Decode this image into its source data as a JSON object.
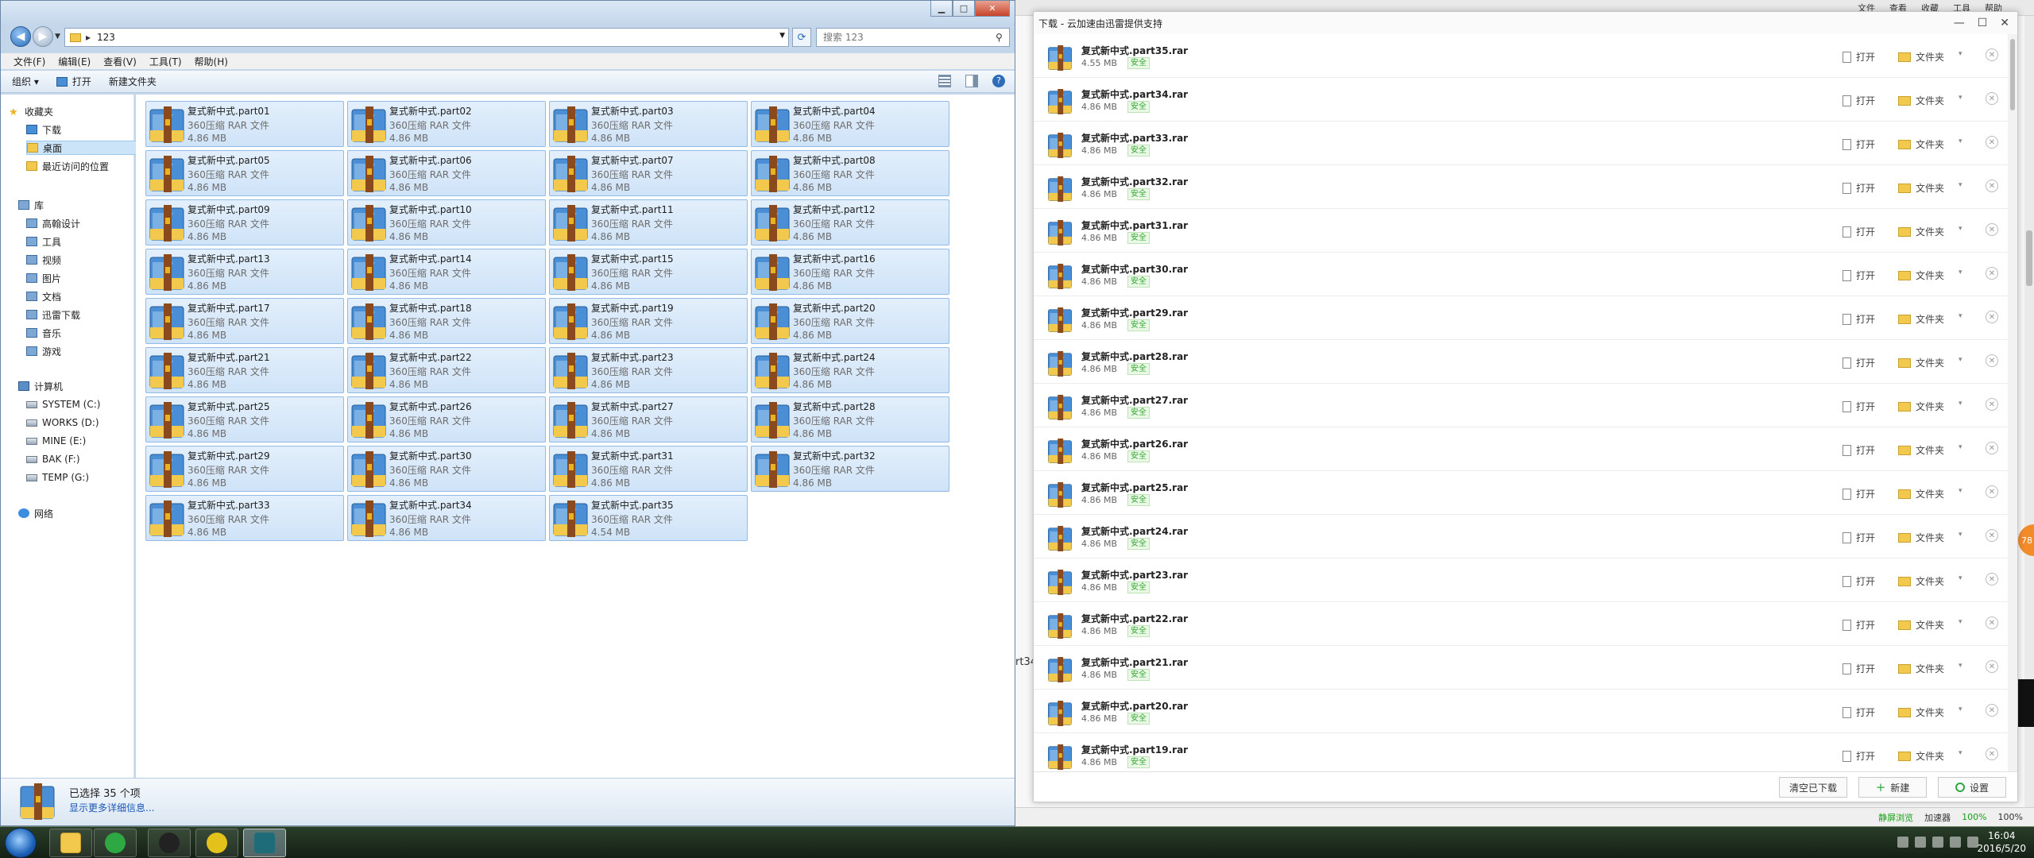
{
  "explorer": {
    "address_path": "123",
    "search_placeholder": "搜索 123",
    "menu": [
      "文件(F)",
      "编辑(E)",
      "查看(V)",
      "工具(T)",
      "帮助(H)"
    ],
    "toolbar": {
      "organize": "组织 ▾",
      "open": "打开",
      "new_folder": "新建文件夹"
    },
    "nav": {
      "favorites": "收藏夹",
      "fav_items": [
        "下载",
        "桌面",
        "最近访问的位置"
      ],
      "libraries": "库",
      "lib_items": [
        "高翰设计",
        "工具",
        "视频",
        "图片",
        "文档",
        "迅雷下载",
        "音乐",
        "游戏"
      ],
      "computer": "计算机",
      "drives": [
        "SYSTEM (C:)",
        "WORKS (D:)",
        "MINE (E:)",
        "BAK (F:)",
        "TEMP (G:)"
      ],
      "network": "网络"
    },
    "files": [
      {
        "name": "复式新中式.part01",
        "type": "360压缩 RAR 文件",
        "size": "4.86 MB"
      },
      {
        "name": "复式新中式.part02",
        "type": "360压缩 RAR 文件",
        "size": "4.86 MB"
      },
      {
        "name": "复式新中式.part03",
        "type": "360压缩 RAR 文件",
        "size": "4.86 MB"
      },
      {
        "name": "复式新中式.part04",
        "type": "360压缩 RAR 文件",
        "size": "4.86 MB"
      },
      {
        "name": "复式新中式.part05",
        "type": "360压缩 RAR 文件",
        "size": "4.86 MB"
      },
      {
        "name": "复式新中式.part06",
        "type": "360压缩 RAR 文件",
        "size": "4.86 MB"
      },
      {
        "name": "复式新中式.part07",
        "type": "360压缩 RAR 文件",
        "size": "4.86 MB"
      },
      {
        "name": "复式新中式.part08",
        "type": "360压缩 RAR 文件",
        "size": "4.86 MB"
      },
      {
        "name": "复式新中式.part09",
        "type": "360压缩 RAR 文件",
        "size": "4.86 MB"
      },
      {
        "name": "复式新中式.part10",
        "type": "360压缩 RAR 文件",
        "size": "4.86 MB"
      },
      {
        "name": "复式新中式.part11",
        "type": "360压缩 RAR 文件",
        "size": "4.86 MB"
      },
      {
        "name": "复式新中式.part12",
        "type": "360压缩 RAR 文件",
        "size": "4.86 MB"
      },
      {
        "name": "复式新中式.part13",
        "type": "360压缩 RAR 文件",
        "size": "4.86 MB"
      },
      {
        "name": "复式新中式.part14",
        "type": "360压缩 RAR 文件",
        "size": "4.86 MB"
      },
      {
        "name": "复式新中式.part15",
        "type": "360压缩 RAR 文件",
        "size": "4.86 MB"
      },
      {
        "name": "复式新中式.part16",
        "type": "360压缩 RAR 文件",
        "size": "4.86 MB"
      },
      {
        "name": "复式新中式.part17",
        "type": "360压缩 RAR 文件",
        "size": "4.86 MB"
      },
      {
        "name": "复式新中式.part18",
        "type": "360压缩 RAR 文件",
        "size": "4.86 MB"
      },
      {
        "name": "复式新中式.part19",
        "type": "360压缩 RAR 文件",
        "size": "4.86 MB"
      },
      {
        "name": "复式新中式.part20",
        "type": "360压缩 RAR 文件",
        "size": "4.86 MB"
      },
      {
        "name": "复式新中式.part21",
        "type": "360压缩 RAR 文件",
        "size": "4.86 MB"
      },
      {
        "name": "复式新中式.part22",
        "type": "360压缩 RAR 文件",
        "size": "4.86 MB"
      },
      {
        "name": "复式新中式.part23",
        "type": "360压缩 RAR 文件",
        "size": "4.86 MB"
      },
      {
        "name": "复式新中式.part24",
        "type": "360压缩 RAR 文件",
        "size": "4.86 MB"
      },
      {
        "name": "复式新中式.part25",
        "type": "360压缩 RAR 文件",
        "size": "4.86 MB"
      },
      {
        "name": "复式新中式.part26",
        "type": "360压缩 RAR 文件",
        "size": "4.86 MB"
      },
      {
        "name": "复式新中式.part27",
        "type": "360压缩 RAR 文件",
        "size": "4.86 MB"
      },
      {
        "name": "复式新中式.part28",
        "type": "360压缩 RAR 文件",
        "size": "4.86 MB"
      },
      {
        "name": "复式新中式.part29",
        "type": "360压缩 RAR 文件",
        "size": "4.86 MB"
      },
      {
        "name": "复式新中式.part30",
        "type": "360压缩 RAR 文件",
        "size": "4.86 MB"
      },
      {
        "name": "复式新中式.part31",
        "type": "360压缩 RAR 文件",
        "size": "4.86 MB"
      },
      {
        "name": "复式新中式.part32",
        "type": "360压缩 RAR 文件",
        "size": "4.86 MB"
      },
      {
        "name": "复式新中式.part33",
        "type": "360压缩 RAR 文件",
        "size": "4.86 MB"
      },
      {
        "name": "复式新中式.part34",
        "type": "360压缩 RAR 文件",
        "size": "4.86 MB"
      },
      {
        "name": "复式新中式.part35",
        "type": "360压缩 RAR 文件",
        "size": "4.54 MB"
      }
    ],
    "details": {
      "selected": "已选择 35 个项",
      "more": "显示更多详细信息..."
    }
  },
  "downloads": {
    "title": "下载 - 云加速由迅雷提供支持",
    "open_label": "打开",
    "folder_label": "文件夹",
    "safe_label": "安全",
    "items": [
      {
        "name": "复式新中式.part35.rar",
        "size": "4.55 MB"
      },
      {
        "name": "复式新中式.part34.rar",
        "size": "4.86 MB"
      },
      {
        "name": "复式新中式.part33.rar",
        "size": "4.86 MB"
      },
      {
        "name": "复式新中式.part32.rar",
        "size": "4.86 MB"
      },
      {
        "name": "复式新中式.part31.rar",
        "size": "4.86 MB"
      },
      {
        "name": "复式新中式.part30.rar",
        "size": "4.86 MB"
      },
      {
        "name": "复式新中式.part29.rar",
        "size": "4.86 MB"
      },
      {
        "name": "复式新中式.part28.rar",
        "size": "4.86 MB"
      },
      {
        "name": "复式新中式.part27.rar",
        "size": "4.86 MB"
      },
      {
        "name": "复式新中式.part26.rar",
        "size": "4.86 MB"
      },
      {
        "name": "复式新中式.part25.rar",
        "size": "4.86 MB"
      },
      {
        "name": "复式新中式.part24.rar",
        "size": "4.86 MB"
      },
      {
        "name": "复式新中式.part23.rar",
        "size": "4.86 MB"
      },
      {
        "name": "复式新中式.part22.rar",
        "size": "4.86 MB"
      },
      {
        "name": "复式新中式.part21.rar",
        "size": "4.86 MB"
      },
      {
        "name": "复式新中式.part20.rar",
        "size": "4.86 MB"
      },
      {
        "name": "复式新中式.part19.rar",
        "size": "4.86 MB"
      }
    ],
    "footer": {
      "clear": "清空已下载",
      "new": "新建",
      "settings": "设置"
    }
  },
  "browser_bg": {
    "top_menu": [
      "文件",
      "查看",
      "收藏",
      "工具",
      "帮助"
    ],
    "side_text": "rt34",
    "status": {
      "sharing": "静屏浏览",
      "accelerator": "加速器",
      "download_pct": "100%",
      "zoom": "100%"
    }
  },
  "orange_badge": "78",
  "clock": {
    "time": "16:04",
    "date": "2016/5/20"
  },
  "colors": {
    "accent_green": "#2ea842",
    "safe_green": "#34a834",
    "selection_blue": "#cfe3f8"
  }
}
